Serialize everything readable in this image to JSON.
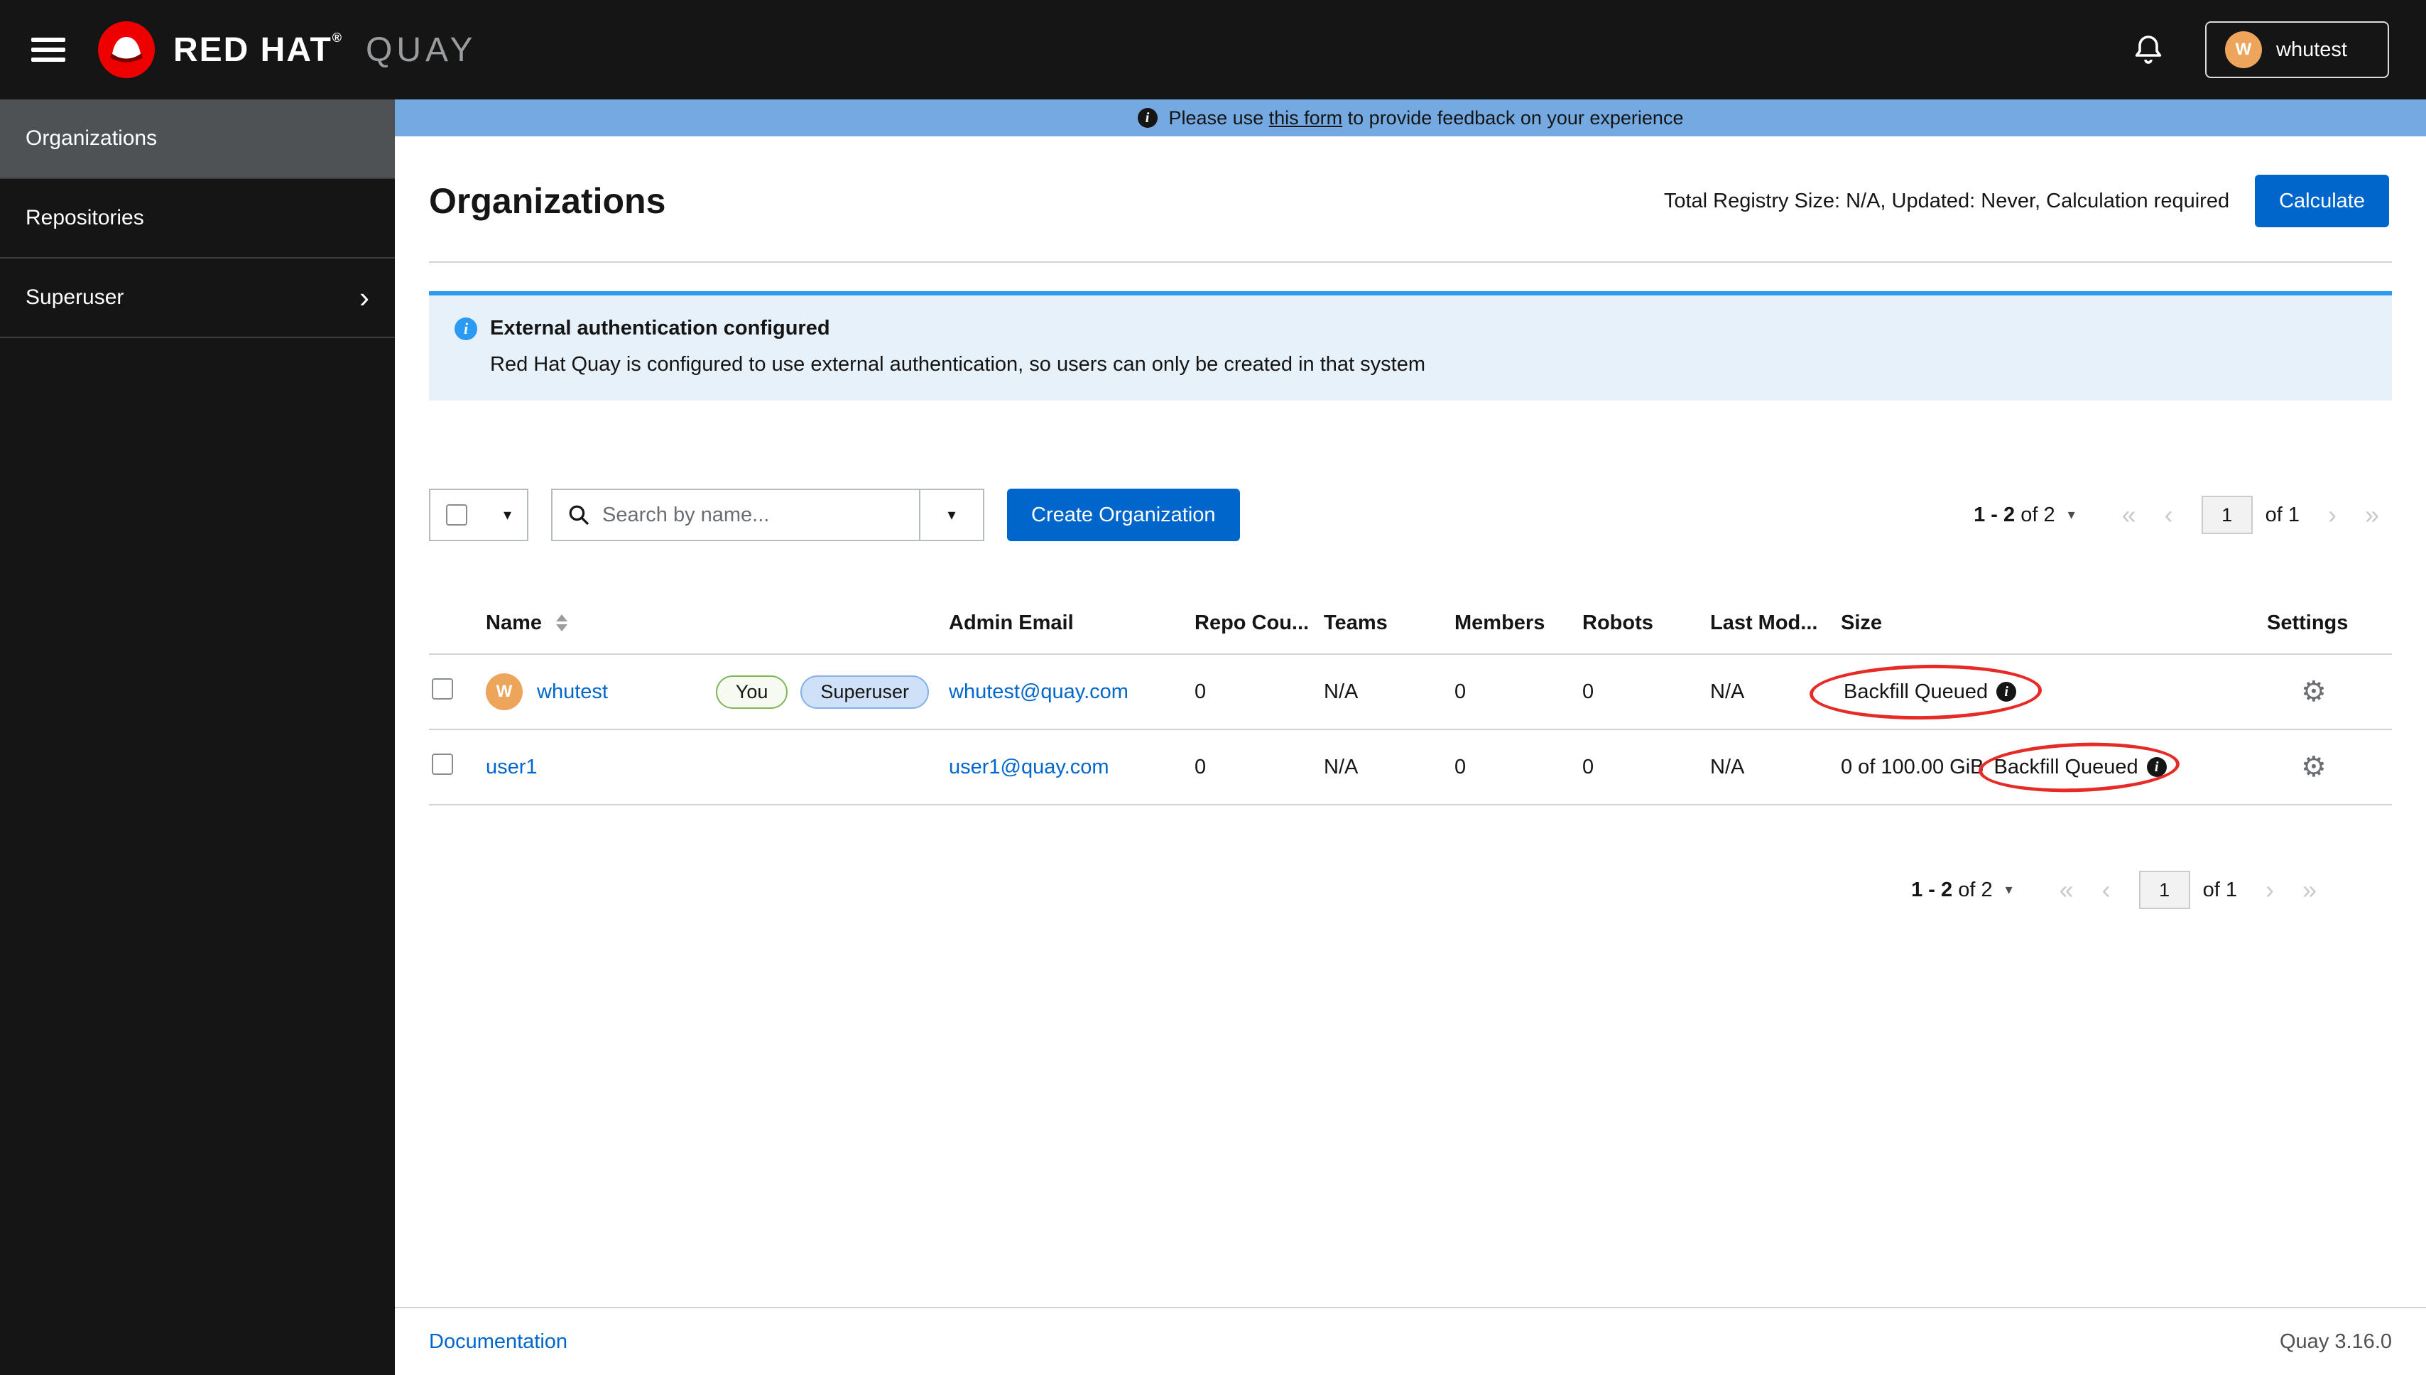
{
  "colors": {
    "accent_blue": "#0066cc",
    "banner_blue": "#74a9e2",
    "alert_blue": "#2b9af3",
    "annotation_red": "#e62a25",
    "avatar_orange": "#eda55c",
    "brand_red": "#ee0000",
    "masthead_black": "#151515"
  },
  "icons": {
    "hamburger": "menu-bars",
    "bell": "notification-bell",
    "caret_down": "▾",
    "chevron_right": "›",
    "search": "magnifier",
    "sort": "up-down-triangles",
    "info": "i",
    "gear": "⚙",
    "page_first": "«",
    "page_prev": "‹",
    "page_next": "›",
    "page_last": "»"
  },
  "header": {
    "brand_red_hat": "RED HAT",
    "brand_reg": "®",
    "brand_quay": "QUAY",
    "user_name": "whutest",
    "user_initial": "W"
  },
  "sidebar": {
    "items": [
      {
        "label": "Organizations"
      },
      {
        "label": "Repositories"
      },
      {
        "label": "Superuser"
      }
    ]
  },
  "banner": {
    "prefix": "Please use ",
    "link_text": "this form",
    "suffix": " to provide feedback on your experience"
  },
  "page_header": {
    "title": "Organizations",
    "registry_summary": "Total Registry Size: N/A, Updated: Never, Calculation required",
    "calculate_button": "Calculate"
  },
  "alert": {
    "title": "External authentication configured",
    "description": "Red Hat Quay is configured to use external authentication, so users can only be created in that system"
  },
  "toolbar": {
    "search_placeholder": "Search by name...",
    "create_button": "Create Organization"
  },
  "pagination": {
    "range_bold": "1 - 2",
    "range_rest": "of 2",
    "page": "1",
    "page_total": "of 1"
  },
  "table": {
    "headers": {
      "name": "Name",
      "admin_email": "Admin Email",
      "repo_count": "Repo Cou...",
      "teams": "Teams",
      "members": "Members",
      "robots": "Robots",
      "last_modified": "Last Mod...",
      "size": "Size",
      "settings": "Settings"
    },
    "rows": [
      {
        "name": "whutest",
        "avatar_initial": "W",
        "badge_you": "You",
        "badge_superuser": "Superuser",
        "admin_email": "whutest@quay.com",
        "repo_count": "0",
        "teams": "N/A",
        "members": "0",
        "robots": "0",
        "last_modified": "N/A",
        "size_status": "Backfill Queued"
      },
      {
        "name": "user1",
        "admin_email": "user1@quay.com",
        "repo_count": "0",
        "teams": "N/A",
        "members": "0",
        "robots": "0",
        "last_modified": "N/A",
        "size_used": "0 of 100.00 GiB",
        "size_status": "Backfill Queued"
      }
    ]
  },
  "footer": {
    "documentation_link": "Documentation",
    "version": "Quay 3.16.0"
  }
}
